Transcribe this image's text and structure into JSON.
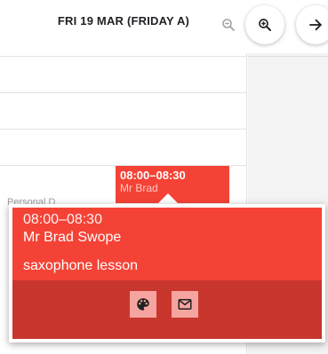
{
  "header": {
    "date_title": "FRI 19 MAR (FRIDAY A)"
  },
  "event_block": {
    "time": "08:00–08:30",
    "name": "Mr Brad"
  },
  "faded_event": {
    "text": "Personal D"
  },
  "popover": {
    "time": "08:00–08:30",
    "teacher": "Mr Brad Swope",
    "description": "saxophone lesson"
  },
  "colors": {
    "event_red": "#f44336",
    "event_footer_red": "#c9362d",
    "button_pink": "#f5a49f"
  },
  "icons": {
    "zoom_out": "zoom-out-icon",
    "zoom_in": "zoom-in-icon",
    "next": "arrow-right-icon",
    "palette": "palette-icon",
    "email": "email-icon"
  }
}
